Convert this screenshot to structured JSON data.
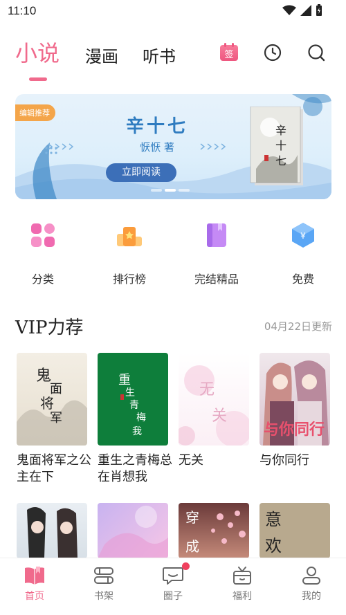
{
  "status": {
    "time": "11:10"
  },
  "top_tabs": [
    {
      "label": "小说"
    },
    {
      "label": "漫画"
    },
    {
      "label": "听书"
    }
  ],
  "checkin_label": "签",
  "banner": {
    "badge": "编辑推荐",
    "title": "辛十七",
    "author": "恹恹 著",
    "button": "立即阅读",
    "cover_text": "辛十七"
  },
  "categories": [
    {
      "label": "分类",
      "icon": "grid-icon"
    },
    {
      "label": "排行榜",
      "icon": "podium-icon"
    },
    {
      "label": "完结精品",
      "icon": "book-icon"
    },
    {
      "label": "免费",
      "icon": "yuan-hexagon-icon"
    }
  ],
  "vip": {
    "title": "VIP力荐",
    "date": "04月22日更新",
    "books": [
      {
        "title": "鬼面将军之公主在下",
        "cover_text": "鬼面将军"
      },
      {
        "title": "重生之青梅总在肖想我",
        "cover_text": "重生之青梅总在肖想我"
      },
      {
        "title": "无关",
        "cover_text": "无关"
      },
      {
        "title": "与你同行",
        "cover_text": "与你同行"
      }
    ],
    "second_row_cover_text": [
      "",
      "",
      "穿越成",
      "意欢"
    ]
  },
  "bottom_nav": [
    {
      "label": "首页",
      "icon": "home-book-icon",
      "active": true
    },
    {
      "label": "书架",
      "icon": "bookshelf-icon",
      "active": false
    },
    {
      "label": "圈子",
      "icon": "chat-bubble-icon",
      "active": false,
      "badge": true
    },
    {
      "label": "福利",
      "icon": "gift-icon",
      "active": false
    },
    {
      "label": "我的",
      "icon": "profile-icon",
      "active": false
    }
  ],
  "colors": {
    "accent": "#F06A8C",
    "banner_button": "#3C6FB8",
    "badge": "#F4A54A"
  }
}
